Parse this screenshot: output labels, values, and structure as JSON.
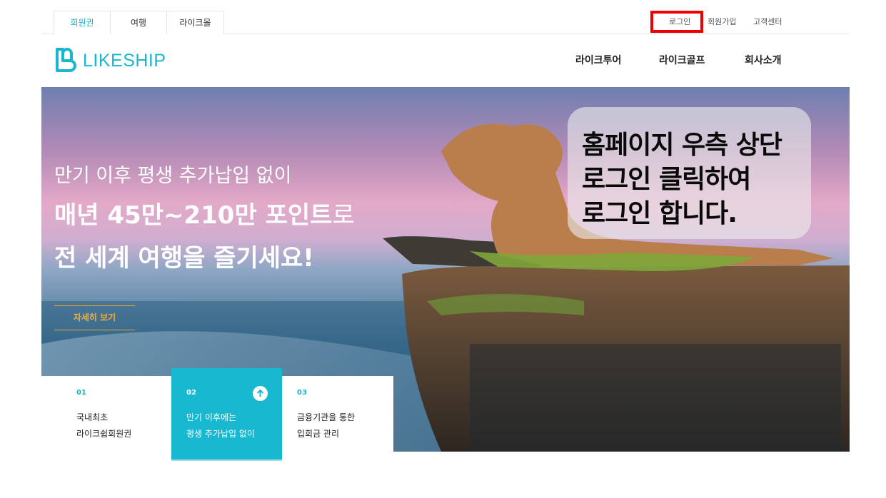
{
  "top_tabs": [
    "회원권",
    "여행",
    "라이크몰"
  ],
  "util_links": {
    "login": "로그인",
    "signup": "회원가입",
    "support": "고객센터"
  },
  "logo_text": "LIKESHIP",
  "main_nav": [
    "라이크투어",
    "라이크골프",
    "회사소개"
  ],
  "hero": {
    "line1": "만기 이후 평생 추가납입 없이",
    "line2_bold": "매년 45만~210만 포인트",
    "line2_suffix": "로",
    "line3": "전 세계 여행을 즐기세요!",
    "detail_button": "자세히 보기"
  },
  "callout": {
    "lines": [
      "홈페이지 우측 상단",
      "로그인 클릭하여",
      "로그인 합니다."
    ]
  },
  "features": [
    {
      "num": "01",
      "lines": [
        "국내최초",
        "라이크쉽회원권"
      ]
    },
    {
      "num": "02",
      "lines": [
        "만기 이후에는",
        "평생 추가납입 없이"
      ]
    },
    {
      "num": "03",
      "lines": [
        "금융기관을 통한",
        "입회금 관리"
      ]
    }
  ],
  "colors": {
    "accent": "#17b4cc",
    "highlight": "#ee0000",
    "cta": "#e8a52b"
  }
}
